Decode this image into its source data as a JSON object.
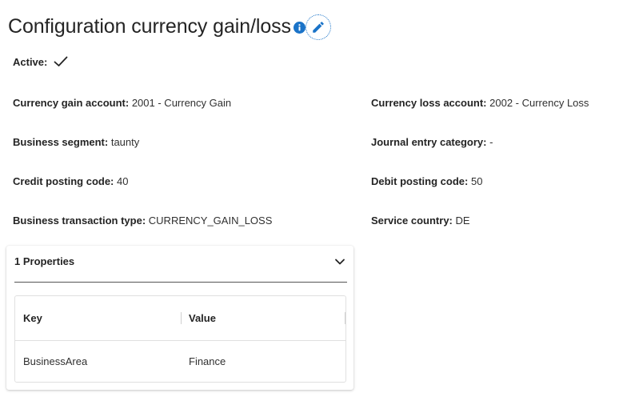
{
  "page": {
    "title": "Configuration currency gain/loss",
    "info_icon": "info-icon",
    "edit_icon": "pencil-icon"
  },
  "fields": {
    "active": {
      "label": "Active:",
      "value_icon": "checkmark-icon"
    },
    "currency_gain_account": {
      "label": "Currency gain account:",
      "value": "2001 - Currency Gain"
    },
    "currency_loss_account": {
      "label": "Currency loss account:",
      "value": "2002 - Currency Loss"
    },
    "business_segment": {
      "label": "Business segment:",
      "value": "taunty"
    },
    "journal_entry_category": {
      "label": "Journal entry category:",
      "value": "-"
    },
    "credit_posting_code": {
      "label": "Credit posting code:",
      "value": "40"
    },
    "debit_posting_code": {
      "label": "Debit posting code:",
      "value": "50"
    },
    "business_transaction_type": {
      "label": "Business transaction type:",
      "value": "CURRENCY_GAIN_LOSS"
    },
    "service_country": {
      "label": "Service country:",
      "value": "DE"
    }
  },
  "properties": {
    "title": "1 Properties",
    "expanded": true,
    "toggle_icon": "chevron-down-icon",
    "columns": [
      "Key",
      "Value"
    ],
    "rows": [
      {
        "key": "BusinessArea",
        "value": "Finance"
      }
    ]
  },
  "colors": {
    "accent": "#1a73c8",
    "text": "#242424"
  }
}
